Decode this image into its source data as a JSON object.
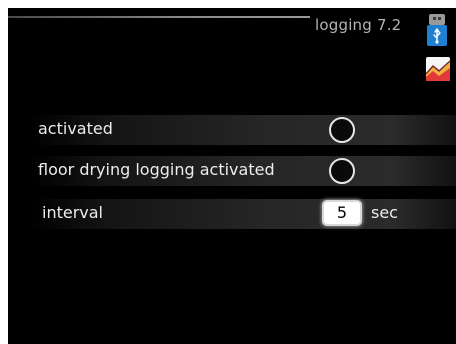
{
  "header": {
    "title": "logging 7.2",
    "icons": [
      "usb-icon",
      "graph-icon"
    ]
  },
  "settings": [
    {
      "label": "activated",
      "control": "radio",
      "selected": false
    },
    {
      "label": "floor drying logging activated",
      "control": "radio",
      "selected": false
    },
    {
      "label": "interval",
      "control": "number",
      "value": "5",
      "unit": "sec"
    }
  ],
  "colors": {
    "background": "#000000",
    "text": "#ececec",
    "title": "#b4b4b4",
    "usb_icon_accent": "#1f7fd1"
  }
}
